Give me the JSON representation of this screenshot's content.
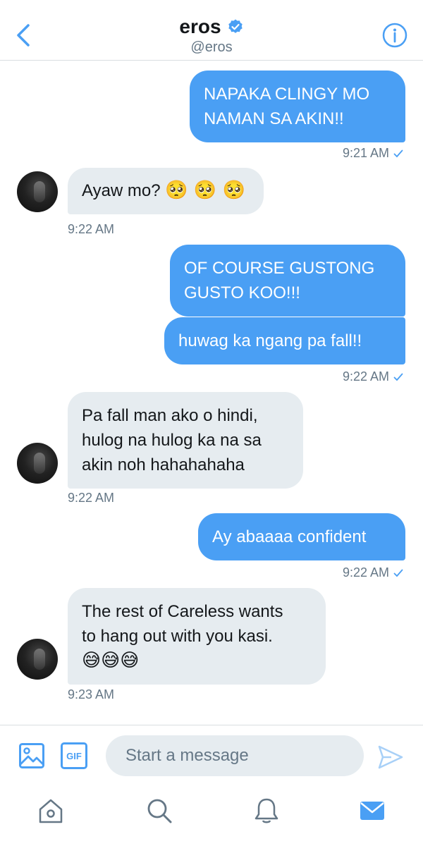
{
  "header": {
    "title": "eros",
    "handle": "@eros",
    "back_icon": "chevron-left-icon",
    "verified_icon": "verified-badge-icon",
    "info_icon": "info-icon"
  },
  "messages": [
    {
      "from": "me",
      "lines": [
        "NAPAKA CLINGY MO",
        "NAMAN SA AKIN!!"
      ],
      "time": "9:21 AM"
    },
    {
      "from": "them",
      "text": "Ayaw mo?",
      "emoji": "🥺 🥺 🥺",
      "time": "9:22 AM"
    },
    {
      "from": "me",
      "lines": [
        "OF COURSE GUSTONG",
        "GUSTO KOO!!!"
      ]
    },
    {
      "from": "me",
      "lines": [
        "huwag ka ngang pa fall!!"
      ],
      "time": "9:22 AM"
    },
    {
      "from": "them",
      "lines": [
        "Pa fall man ako o hindi,",
        "hulog na hulog ka na sa",
        "akin noh hahahahaha"
      ],
      "time": "9:22 AM"
    },
    {
      "from": "me",
      "lines": [
        "Ay abaaaa confident"
      ],
      "time": "9:22 AM"
    },
    {
      "from": "them",
      "lines": [
        "The rest of Careless wants",
        "to hang out with you kasi."
      ],
      "emoji": "😅😅😅",
      "time": "9:23 AM"
    }
  ],
  "composer": {
    "placeholder": "Start a message",
    "gif_label": "GIF",
    "image_icon": "image-icon",
    "send_icon": "send-icon"
  },
  "tabbar": {
    "items": [
      "home-icon",
      "search-icon",
      "notifications-bell-icon",
      "messages-mail-icon"
    ],
    "active": "messages-mail-icon"
  },
  "colors": {
    "accent": "#4a9ff4",
    "received_bubble": "#e6ecf0",
    "meta_text": "#657786"
  }
}
